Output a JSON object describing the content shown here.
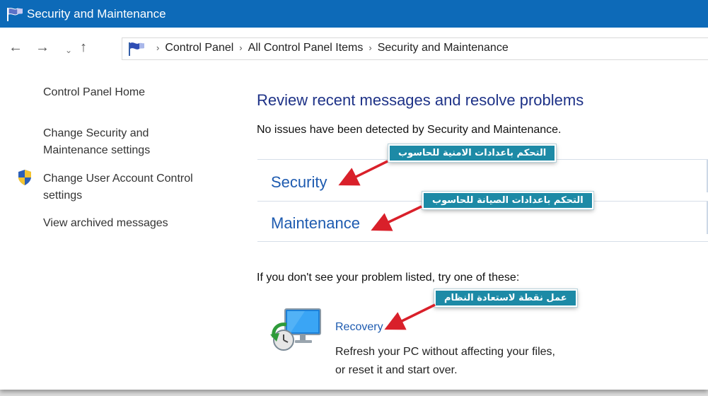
{
  "window": {
    "title": "Security and Maintenance"
  },
  "nav": {
    "back": "←",
    "forward": "→",
    "recent": "⌄",
    "up": "↑"
  },
  "breadcrumb": {
    "separator": "›",
    "items": [
      "Control Panel",
      "All Control Panel Items",
      "Security and Maintenance"
    ]
  },
  "sidebar": {
    "home": "Control Panel Home",
    "change_security": "Change Security and Maintenance settings",
    "change_uac": "Change User Account Control settings",
    "view_archived": "View archived messages"
  },
  "main": {
    "heading": "Review recent messages and resolve problems",
    "status": "No issues have been detected by Security and Maintenance.",
    "security": "Security",
    "maintenance": "Maintenance",
    "suggestion": "If you don't see your problem listed, try one of these:",
    "recovery_link": "Recovery",
    "recovery_desc": "Refresh your PC without affecting your files, or reset it and start over."
  },
  "annotations": {
    "security_note": "التحكم باعدادات الامنية للحاسوب",
    "maintenance_note": "التحكم باعدادات الصيانة للحاسوب",
    "recovery_note": "عمل نقطة لاستعادة النظام"
  },
  "colors": {
    "titlebar": "#0d6ab8",
    "heading": "#1e3287",
    "link": "#1e5bb0",
    "callout": "#1d8aa6",
    "arrow": "#d9202a"
  },
  "icons": [
    "flag-icon",
    "shield-icon",
    "recovery-icon"
  ]
}
